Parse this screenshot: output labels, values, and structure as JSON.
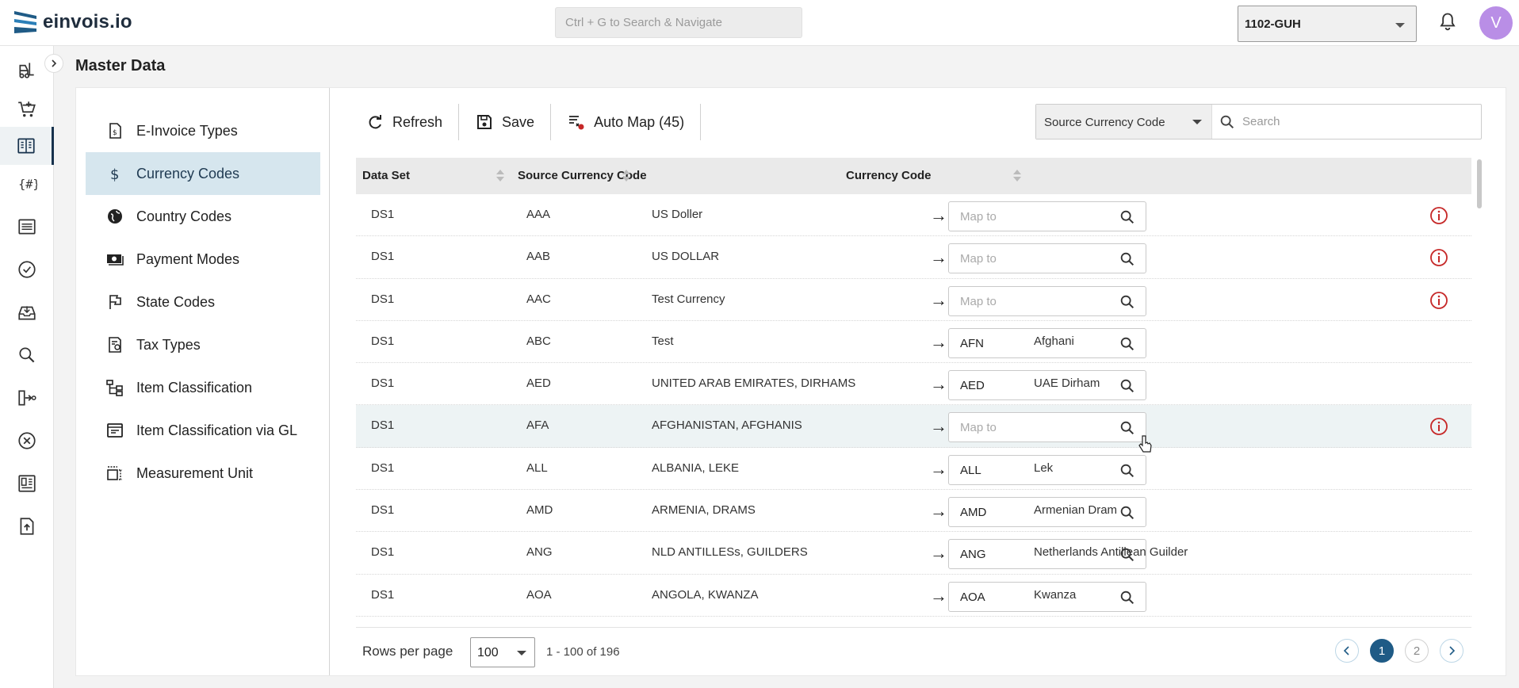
{
  "app": {
    "name": "einvois.io"
  },
  "topbar": {
    "search_placeholder": "Ctrl + G to Search & Navigate",
    "org_selected": "1102-GUH",
    "avatar_initial": "V"
  },
  "page": {
    "title": "Master Data"
  },
  "subnav": {
    "items": [
      {
        "label": "E-Invoice Types",
        "icon": "document-dollar-icon"
      },
      {
        "label": "Currency Codes",
        "icon": "dollar-icon"
      },
      {
        "label": "Country Codes",
        "icon": "globe-icon"
      },
      {
        "label": "Payment Modes",
        "icon": "cash-icon"
      },
      {
        "label": "State Codes",
        "icon": "flag-icon"
      },
      {
        "label": "Tax Types",
        "icon": "tax-document-icon"
      },
      {
        "label": "Item Classification",
        "icon": "hierarchy-icon"
      },
      {
        "label": "Item Classification via GL",
        "icon": "ledger-icon"
      },
      {
        "label": "Measurement Unit",
        "icon": "measure-icon"
      }
    ],
    "active": "Currency Codes"
  },
  "toolbar": {
    "refresh_label": "Refresh",
    "save_label": "Save",
    "automap_label": "Auto Map (45)"
  },
  "filter": {
    "field_selected": "Source Currency Code",
    "search_placeholder": "Search"
  },
  "table": {
    "columns": [
      "Data Set",
      "Source Currency Code",
      "Currency Code"
    ],
    "map_placeholder": "Map to",
    "rows": [
      {
        "dataset": "DS1",
        "code": "AAA",
        "desc": "US Doller",
        "mapped": "",
        "currency_name": "",
        "warning": true
      },
      {
        "dataset": "DS1",
        "code": "AAB",
        "desc": "US DOLLAR",
        "mapped": "",
        "currency_name": "",
        "warning": true
      },
      {
        "dataset": "DS1",
        "code": "AAC",
        "desc": "Test Currency",
        "mapped": "",
        "currency_name": "",
        "warning": true
      },
      {
        "dataset": "DS1",
        "code": "ABC",
        "desc": "Test",
        "mapped": "AFN",
        "currency_name": "Afghani",
        "warning": false
      },
      {
        "dataset": "DS1",
        "code": "AED",
        "desc": "UNITED ARAB EMIRATES, DIRHAMS",
        "mapped": "AED",
        "currency_name": "UAE Dirham",
        "warning": false
      },
      {
        "dataset": "DS1",
        "code": "AFA",
        "desc": "AFGHANISTAN, AFGHANIS",
        "mapped": "",
        "currency_name": "",
        "warning": true
      },
      {
        "dataset": "DS1",
        "code": "ALL",
        "desc": "ALBANIA, LEKE",
        "mapped": "ALL",
        "currency_name": "Lek",
        "warning": false
      },
      {
        "dataset": "DS1",
        "code": "AMD",
        "desc": "ARMENIA, DRAMS",
        "mapped": "AMD",
        "currency_name": "Armenian Dram",
        "warning": false
      },
      {
        "dataset": "DS1",
        "code": "ANG",
        "desc": "NLD ANTILLESs, GUILDERS",
        "mapped": "ANG",
        "currency_name": "Netherlands Antillean Guilder",
        "warning": false
      },
      {
        "dataset": "DS1",
        "code": "AOA",
        "desc": "ANGOLA, KWANZA",
        "mapped": "AOA",
        "currency_name": "Kwanza",
        "warning": false
      }
    ]
  },
  "footer": {
    "rows_per_page_label": "Rows per page",
    "rows_per_page_value": "100",
    "range_text": "1 - 100 of 196",
    "pages": [
      "1",
      "2"
    ],
    "current_page": "1"
  }
}
